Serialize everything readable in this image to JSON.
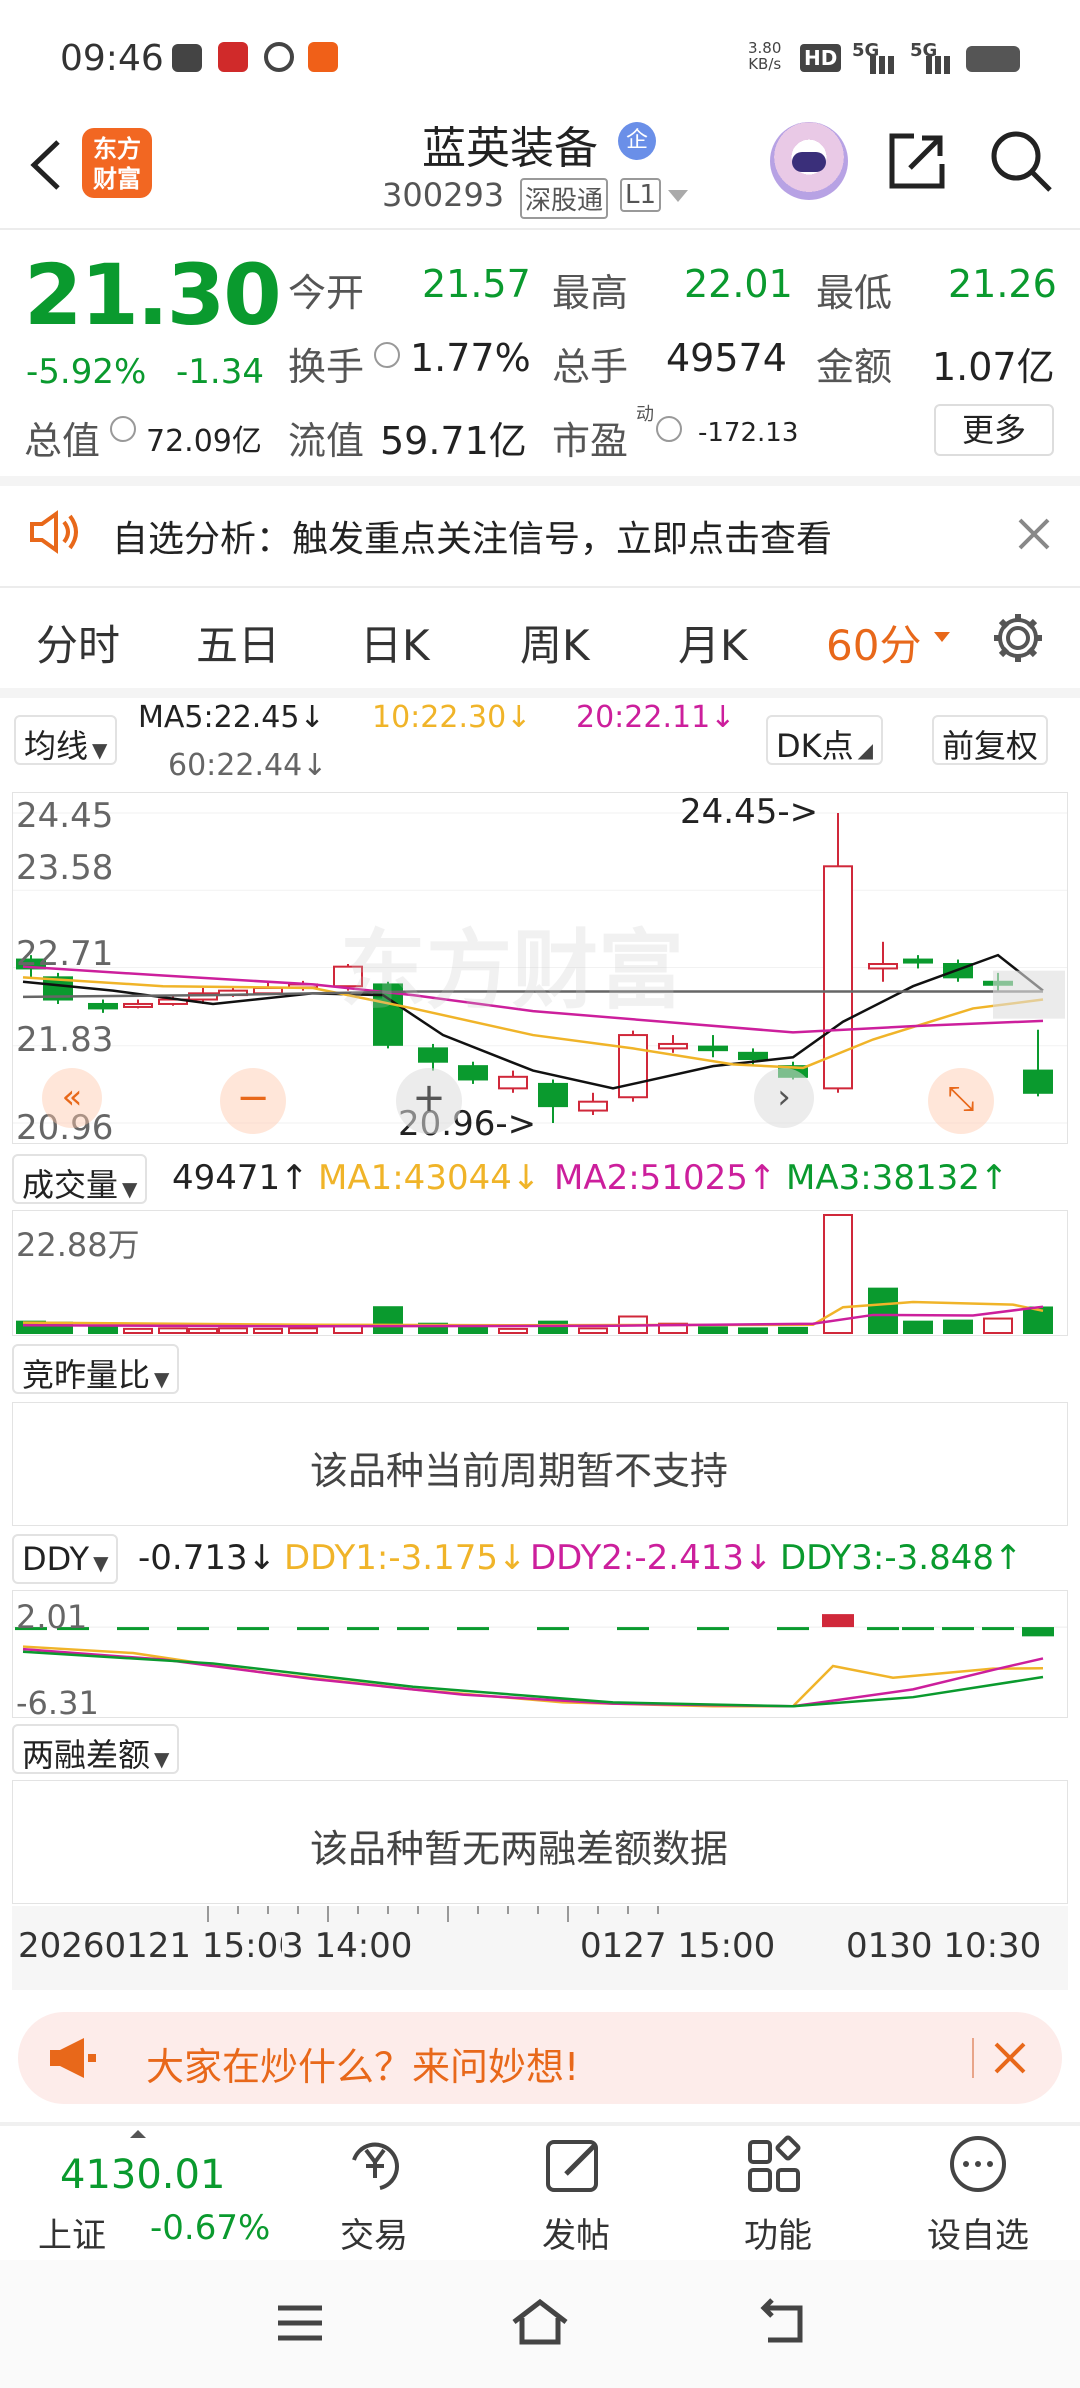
{
  "status_bar": {
    "time": "09:46",
    "net_speed": "3.80",
    "net_unit": "KB/s",
    "hd": "HD",
    "sig1": "5G",
    "sig2": "5G"
  },
  "header": {
    "title": "蓝英装备",
    "badge": "企",
    "code": "300293",
    "market": "深股通",
    "level": "L1",
    "logo_line1": "东方",
    "logo_line2": "财富"
  },
  "quote": {
    "price": "21.30",
    "pct": "-5.92%",
    "chg": "-1.34",
    "open_label": "今开",
    "open": "21.57",
    "high_label": "最高",
    "high": "22.01",
    "low_label": "最低",
    "low": "21.26",
    "turnover_label": "换手",
    "turnover": "1.77%",
    "volume_label": "总手",
    "volume": "49574",
    "amount_label": "金额",
    "amount": "1.07亿",
    "mktcap_label": "总值",
    "mktcap": "72.09亿",
    "float_label": "流值",
    "float": "59.71亿",
    "pe_label": "市盈",
    "pe_sup": "动",
    "pe": "-172.13",
    "more": "更多"
  },
  "notice": {
    "text": "自选分析：触发重点关注信号，立即点击查看"
  },
  "tabs": [
    "分时",
    "五日",
    "日K",
    "周K",
    "月K",
    "60分"
  ],
  "chart_header": {
    "ma_dropdown": "均线",
    "ma5": "MA5:22.45↓",
    "ma10": "10:22.30↓",
    "ma20": "20:22.11↓",
    "ma60": "60:22.44↓",
    "dk": "DK点",
    "adj": "前复权"
  },
  "kline_axis": {
    "y1": "24.45",
    "y2": "23.58",
    "y3": "22.71",
    "y4": "21.83",
    "y5": "20.96",
    "high_mark": "24.45->",
    "low_mark": "20.96->",
    "watermark": "东方财富"
  },
  "volume_panel": {
    "dropdown": "成交量",
    "value": "49471↑",
    "ma1": "MA1:43044↓",
    "ma2": "MA2:51025↑",
    "ma3": "MA3:38132↑",
    "ymax": "22.88万"
  },
  "auction_panel": {
    "dropdown": "竞昨量比",
    "message": "该品种当前周期暂不支持"
  },
  "ddy_panel": {
    "dropdown": "DDY",
    "value": "-0.713↓",
    "ddy1": "DDY1:-3.175↓",
    "ddy2": "DDY2:-2.413↓",
    "ddy3": "DDY3:-3.848↑",
    "ytop": "2.01",
    "ybot": "-6.31"
  },
  "margin_panel": {
    "dropdown": "两融差额",
    "message": "该品种暂无两融差额数据"
  },
  "time_axis": {
    "t1": "20260121 15:00",
    "t2": "3 14:00",
    "t3": "0127 15:00",
    "t4": "0130 10:30"
  },
  "ai_banner": {
    "text": "大家在炒什么？来问妙想!"
  },
  "bottom_nav": {
    "index_value": "4130.01",
    "index_name": "上证",
    "index_pct": "-0.67%",
    "trade": "交易",
    "post": "发帖",
    "func": "功能",
    "watch": "设自选"
  },
  "colors": {
    "up": "#d0283a",
    "down": "#0a9a2e",
    "accent": "#e8681a",
    "ma5": "#111111",
    "ma10": "#f0b429",
    "ma20": "#cc1f9c",
    "ma60": "#666666"
  }
}
